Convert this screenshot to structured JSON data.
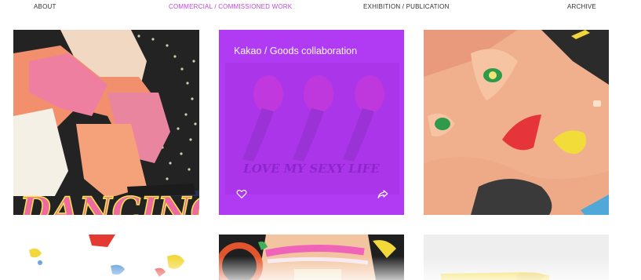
{
  "nav": {
    "items": [
      {
        "label": "ABOUT"
      },
      {
        "label": "COMMERCIAL / COMMISSIONED WORK",
        "active": true
      },
      {
        "label": "EXHIBITION / PUBLICATION"
      },
      {
        "label": "ARCHIVE"
      }
    ],
    "active_color": "#c445e8",
    "text_color": "#333333"
  },
  "gallery": {
    "tiles": [
      {
        "artwork_text": "DANCING"
      },
      {
        "title": "Kakao / Goods collaboration",
        "artwork_text": "LOVE MY SEXY LIFE",
        "overlay_color": "#b13bf2",
        "icons": [
          "heart-icon",
          "share-icon"
        ]
      },
      {},
      {},
      {},
      {}
    ]
  }
}
